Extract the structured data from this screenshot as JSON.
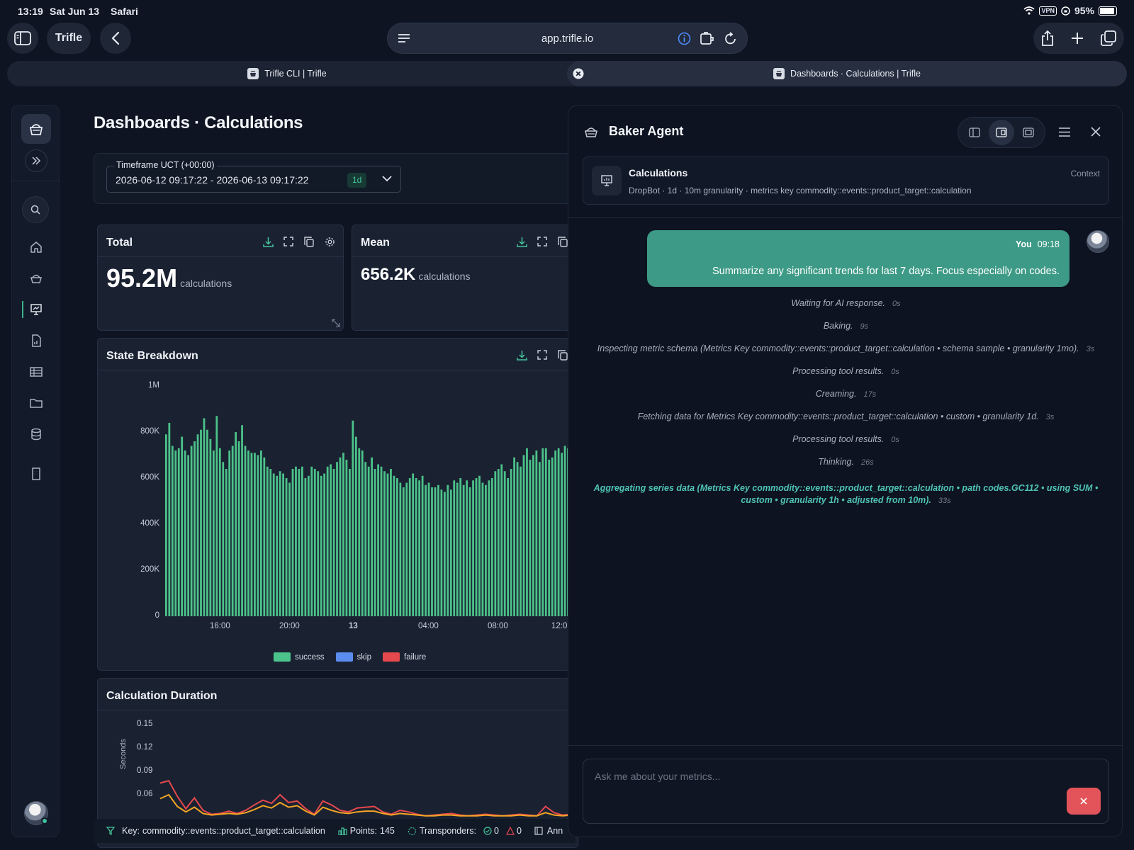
{
  "status_bar": {
    "time": "13:19",
    "date": "Sat Jun 13",
    "app": "Safari",
    "vpn": "VPN",
    "battery": "95%"
  },
  "browser": {
    "app_pill": "Trifle",
    "url": "app.trifle.io",
    "tabs": [
      {
        "title": "Trifle CLI | Trifle"
      },
      {
        "title": "Dashboards · Calculations | Trifle"
      }
    ]
  },
  "page": {
    "title": "Dashboards · Calculations",
    "timeframe": {
      "label": "Timeframe UCT (+00:00)",
      "value": "2026-06-12 09:17:22 - 2026-06-13 09:17:22",
      "badge": "1d"
    }
  },
  "widgets": {
    "total": {
      "title": "Total",
      "value": "95.2M",
      "unit": "calculations"
    },
    "mean": {
      "title": "Mean",
      "value": "656.2K",
      "unit": "calculations"
    },
    "state_breakdown": {
      "title": "State Breakdown"
    },
    "duration": {
      "title": "Calculation Duration",
      "ylabel": "Seconds"
    }
  },
  "chart_data": [
    {
      "type": "bar",
      "title": "State Breakdown",
      "ylim": [
        0,
        1000000
      ],
      "y_ticks": [
        "1M",
        "800K",
        "600K",
        "400K",
        "200K",
        "0"
      ],
      "x_ticks": [
        "16:00",
        "20:00",
        "13",
        "04:00",
        "08:00",
        "12:0"
      ],
      "legend": [
        {
          "name": "success",
          "color": "#4cc38a"
        },
        {
          "name": "skip",
          "color": "#5b8def"
        },
        {
          "name": "failure",
          "color": "#e5484d"
        }
      ],
      "series": [
        {
          "name": "success",
          "values": [
            790,
            840,
            740,
            720,
            730,
            780,
            720,
            700,
            740,
            760,
            790,
            810,
            860,
            810,
            770,
            720,
            870,
            730,
            670,
            640,
            720,
            740,
            800,
            760,
            830,
            740,
            720,
            710,
            710,
            700,
            720,
            690,
            650,
            640,
            620,
            610,
            630,
            620,
            600,
            580,
            640,
            650,
            640,
            650,
            600,
            610,
            650,
            640,
            630,
            610,
            620,
            650,
            660,
            640,
            670,
            690,
            710,
            680,
            640,
            850,
            780,
            730,
            720,
            670,
            650,
            690,
            640,
            660,
            650,
            630,
            620,
            640,
            610,
            600,
            580,
            560,
            580,
            600,
            620,
            600,
            590,
            610,
            570,
            580,
            560,
            560,
            570,
            550,
            540,
            570,
            550,
            590,
            580,
            600,
            570,
            590,
            560,
            590,
            600,
            610,
            580,
            570,
            590,
            600,
            630,
            640,
            660,
            630,
            600,
            640,
            690,
            670,
            650,
            700,
            730,
            680,
            700,
            720,
            670,
            730,
            730,
            680,
            690,
            720,
            730,
            710,
            740,
            730,
            750,
            740,
            730
          ]
        },
        {
          "name": "skip",
          "values": []
        },
        {
          "name": "failure",
          "values": []
        }
      ]
    },
    {
      "type": "line",
      "title": "Calculation Duration",
      "ylabel": "Seconds",
      "y_ticks": [
        "0.15",
        "0.12",
        "0.09",
        "0.06"
      ],
      "ylim": [
        0.03,
        0.15
      ],
      "series": [
        {
          "color": "#e5484d",
          "values": [
            0.075,
            0.078,
            0.058,
            0.042,
            0.056,
            0.04,
            0.035,
            0.036,
            0.039,
            0.036,
            0.04,
            0.047,
            0.053,
            0.049,
            0.06,
            0.05,
            0.052,
            0.042,
            0.035,
            0.052,
            0.047,
            0.04,
            0.038,
            0.043,
            0.044,
            0.045,
            0.038,
            0.035,
            0.04,
            0.038,
            0.035,
            0.033,
            0.034,
            0.035,
            0.036,
            0.034,
            0.033,
            0.034,
            0.035,
            0.034,
            0.033,
            0.034,
            0.035,
            0.034,
            0.033,
            0.045,
            0.037,
            0.034,
            0.035,
            0.033
          ]
        },
        {
          "color": "#f5a524",
          "values": [
            0.055,
            0.06,
            0.045,
            0.038,
            0.044,
            0.036,
            0.034,
            0.035,
            0.036,
            0.035,
            0.037,
            0.041,
            0.046,
            0.043,
            0.05,
            0.044,
            0.046,
            0.039,
            0.034,
            0.044,
            0.04,
            0.037,
            0.036,
            0.038,
            0.039,
            0.039,
            0.036,
            0.034,
            0.036,
            0.035,
            0.034,
            0.033,
            0.033,
            0.034,
            0.034,
            0.033,
            0.033,
            0.033,
            0.034,
            0.033,
            0.033,
            0.033,
            0.034,
            0.033,
            0.033,
            0.037,
            0.034,
            0.033,
            0.034,
            0.033
          ]
        }
      ]
    }
  ],
  "footer": {
    "key_label": "Key:",
    "key_value": "commodity::events::product_target::calculation",
    "points_label": "Points:",
    "points_value": "145",
    "transponders_label": "Transponders:",
    "ok_count": "0",
    "warn_count": "0",
    "annotations_label": "Ann"
  },
  "agent": {
    "title": "Baker Agent",
    "context": {
      "title": "Calculations",
      "subtitle": "DropBot · 1d · 10m granularity · metrics key commodity::events::product_target::calculation",
      "tag": "Context"
    },
    "message": {
      "author": "You",
      "time": "09:18",
      "text": "Summarize any significant trends for last 7 days. Focus especially on codes."
    },
    "steps": [
      {
        "text": "Waiting for AI response.",
        "duration": "0s"
      },
      {
        "text": "Baking.",
        "duration": "9s"
      },
      {
        "text": "Inspecting metric schema (Metrics Key commodity::events::product_target::calculation • schema sample • granularity 1mo).",
        "duration": "3s"
      },
      {
        "text": "Processing tool results.",
        "duration": "0s"
      },
      {
        "text": "Creaming.",
        "duration": "17s"
      },
      {
        "text": "Fetching data for Metrics Key commodity::events::product_target::calculation • custom • granularity 1d.",
        "duration": "3s"
      },
      {
        "text": "Processing tool results.",
        "duration": "0s"
      },
      {
        "text": "Thinking.",
        "duration": "26s"
      }
    ],
    "active_step": {
      "line1": "Aggregating series data (Metrics Key commodity::events::product_target::calculation • path codes.GC112 • using SUM •",
      "line2": "custom • granularity 1h • adjusted from 10m).",
      "duration": "33s"
    },
    "input_placeholder": "Ask me about your metrics..."
  },
  "colors": {
    "accent": "#3fb28f",
    "bubble": "#3d9a86",
    "stop": "#e3545a"
  }
}
